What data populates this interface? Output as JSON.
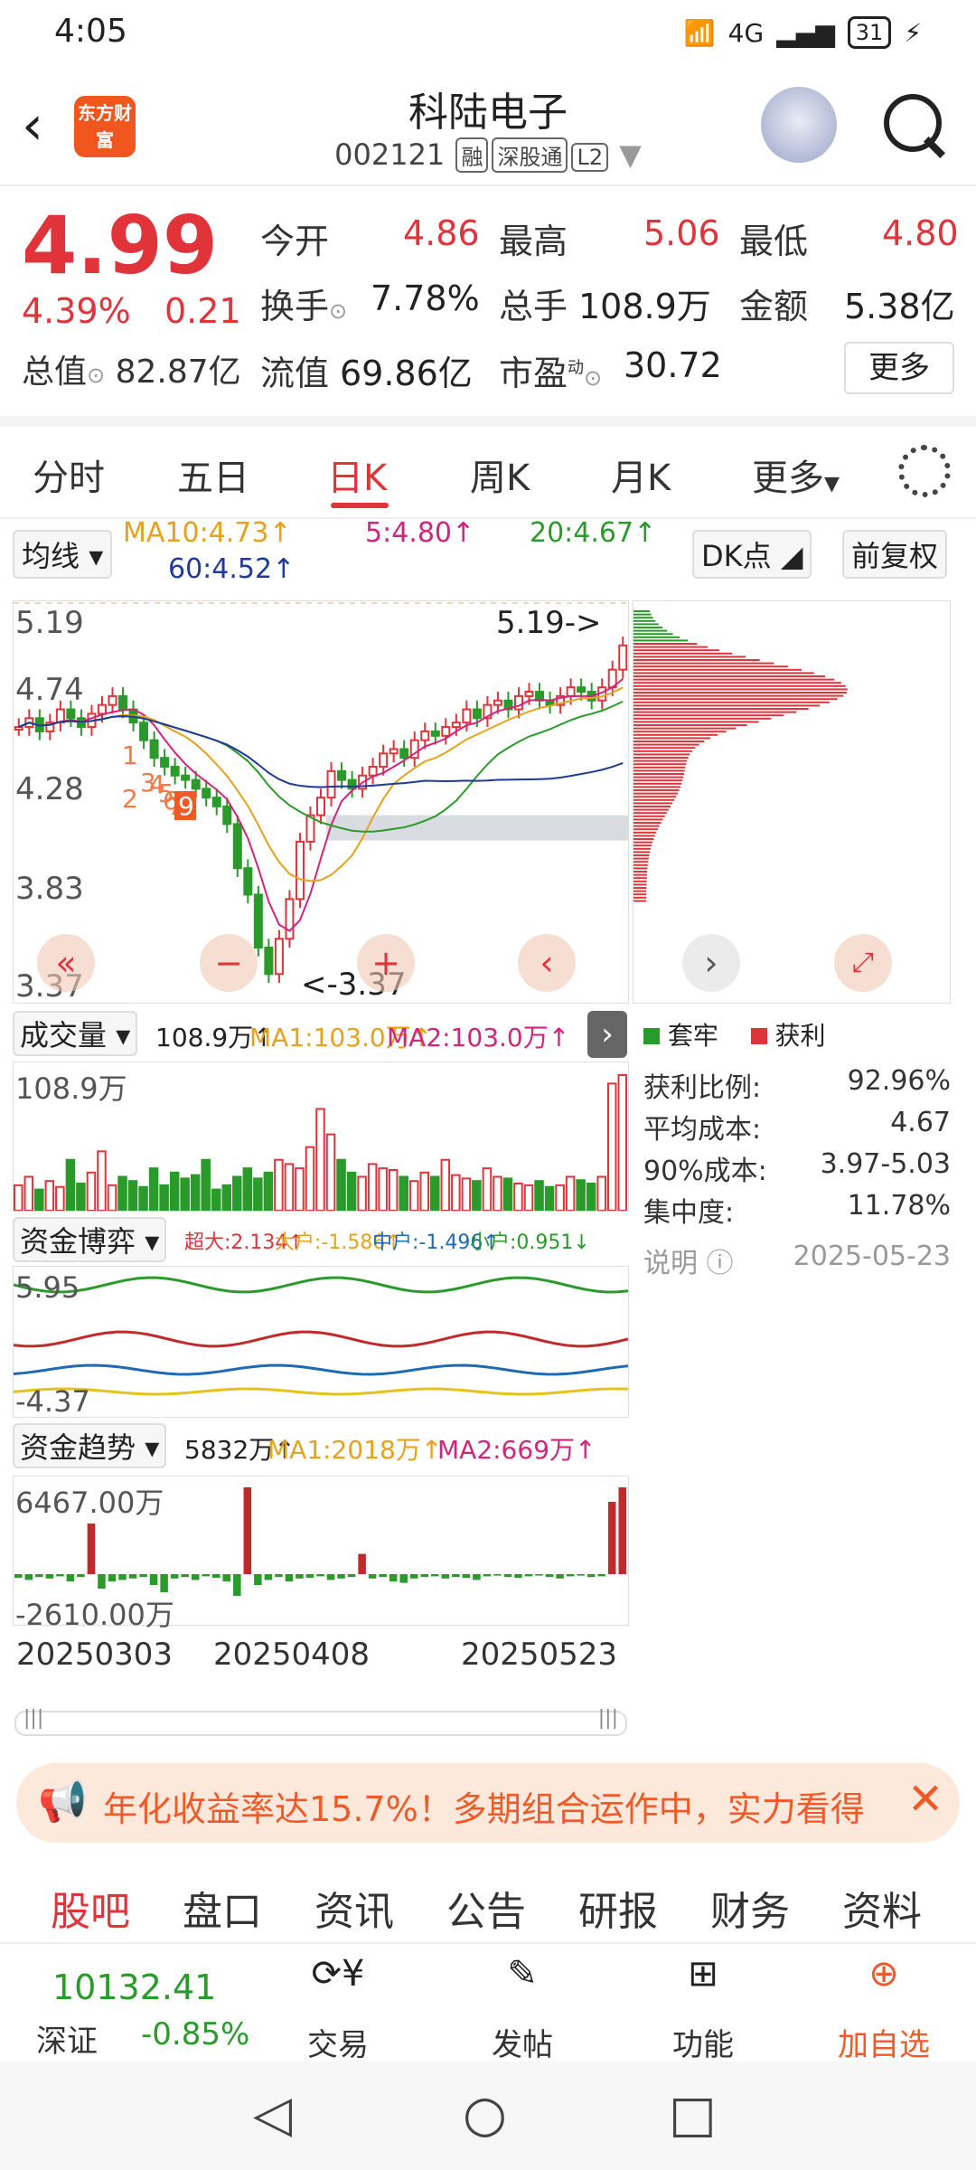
{
  "status_bar": {
    "time": "4:05",
    "network": "4G",
    "battery": "31"
  },
  "header": {
    "logo_text": "东方财富",
    "stock_name": "科陆电子",
    "stock_code": "002121",
    "tags": [
      "融",
      "深股通",
      "L2"
    ]
  },
  "quote": {
    "price": "4.99",
    "change_pct": "4.39%",
    "change": "0.21",
    "total_cap_label": "总值",
    "total_cap": "82.87亿",
    "open_label": "今开",
    "open": "4.86",
    "high_label": "最高",
    "high": "5.06",
    "low_label": "最低",
    "low": "4.80",
    "turnover_label": "换手",
    "turnover": "7.78%",
    "volume_label": "总手",
    "volume": "108.9万",
    "amount_label": "金额",
    "amount": "5.38亿",
    "float_cap_label": "流值",
    "float_cap": "69.86亿",
    "pe_label": "市盈",
    "pe_sup": "动",
    "pe": "30.72",
    "more_label": "更多"
  },
  "tabs": [
    "分时",
    "五日",
    "日K",
    "周K",
    "月K",
    "更多"
  ],
  "ma": {
    "select_label": "均线",
    "ma10": "MA10:4.73↑",
    "ma5": "5:4.80↑",
    "ma20": "20:4.67↑",
    "ma60": "60:4.52↑",
    "dk_label": "DK点",
    "fq_label": "前复权"
  },
  "kline": {
    "y_labels": [
      "5.19",
      "4.74",
      "4.28",
      "3.83",
      "3.37"
    ],
    "max_label": "5.19->",
    "min_label": "<-3.37",
    "markers": [
      "1",
      "2",
      "3",
      "4",
      "5",
      "6",
      "7",
      "8",
      "9"
    ],
    "controls": [
      "«",
      "−",
      "+",
      "‹",
      "›"
    ]
  },
  "chips": {
    "legend_trap": "套牢",
    "legend_profit": "获利",
    "rows": [
      {
        "label": "获利比例:",
        "value": "92.96%"
      },
      {
        "label": "平均成本:",
        "value": "4.67"
      },
      {
        "label": "90%成本:",
        "value": "3.97-5.03"
      },
      {
        "label": "集中度:",
        "value": "11.78%"
      }
    ],
    "note_label": "说明",
    "date": "2025-05-23"
  },
  "volume_panel": {
    "select_label": "成交量",
    "value": "108.9万↑",
    "ma1": "MA1:103.0万↑",
    "ma2": "MA2:103.0万↑",
    "y_top": "108.9万"
  },
  "fund_game": {
    "select_label": "资金博弈",
    "super": "超大:2.134↑",
    "big": "大户:-1.586↑",
    "mid": "中户:-1.496↑",
    "small": "小户:0.951↓",
    "y_top": "5.95",
    "y_bottom": "-4.37"
  },
  "fund_trend": {
    "select_label": "资金趋势",
    "value": "5832万↑",
    "ma1": "MA1:2018万↑",
    "ma2": "MA2:669万↑",
    "y_top": "6467.00万",
    "y_bottom": "-2610.00万"
  },
  "dates": [
    "20250303",
    "20250408",
    "20250523"
  ],
  "banner": {
    "text": "年化收益率达15.7%！多期组合运作中，实力看得"
  },
  "bottom_tabs": [
    "股吧",
    "盘口",
    "资讯",
    "公告",
    "研报",
    "财务",
    "资料"
  ],
  "footer": {
    "index_value": "10132.41",
    "market": "深证",
    "index_pct": "-0.85%",
    "items": [
      "交易",
      "发帖",
      "功能",
      "加自选"
    ]
  },
  "colors": {
    "up": "#e0333a",
    "down": "#2a9a2a",
    "accent": "#f05a28"
  }
}
